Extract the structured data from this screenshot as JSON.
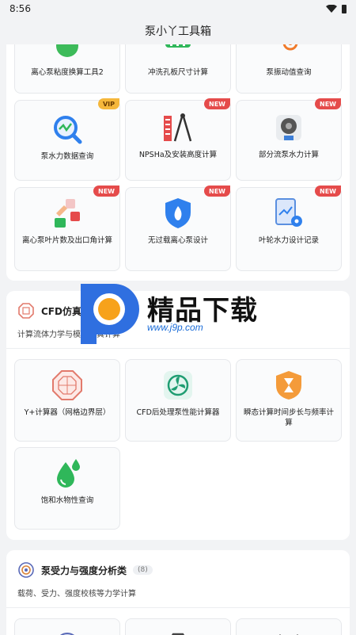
{
  "status_bar": {
    "time": "8:56"
  },
  "app_bar": {
    "title": "泵小丫工具箱"
  },
  "section1": {
    "tiles": [
      {
        "label": "离心泵粘度换算工具2"
      },
      {
        "label": "冲洗孔板尺寸计算"
      },
      {
        "label": "泵振动值查询"
      },
      {
        "label": "泵水力数据查询",
        "badge": "VIP"
      },
      {
        "label": "NPSHa及安装高度计算",
        "badge": "NEW"
      },
      {
        "label": "部分流泵水力计算",
        "badge": "NEW"
      },
      {
        "label": "离心泵叶片数及出口角计算",
        "badge": "NEW"
      },
      {
        "label": "无过载离心泵设计",
        "badge": "NEW"
      },
      {
        "label": "叶轮水力设计记录",
        "badge": "NEW"
      }
    ]
  },
  "section2": {
    "title": "CFD仿真类",
    "description": "计算流体力学与模拟仿真计算",
    "tiles": [
      {
        "label": "Y+计算器（网格边界层）"
      },
      {
        "label": "CFD后处理泵性能计算器"
      },
      {
        "label": "瞬态计算时间步长与频率计算"
      },
      {
        "label": "饱和水物性查询"
      }
    ]
  },
  "section3": {
    "title": "泵受力与强度分析类",
    "count": "(8)",
    "description": "载荷、受力、强度校核等力学计算"
  },
  "watermark": {
    "brand": "精品下载",
    "url": "www.j9p.com"
  },
  "colors": {
    "accent_blue": "#2f80ed",
    "badge_new": "#e54b4b",
    "badge_vip": "#f5b73b"
  }
}
